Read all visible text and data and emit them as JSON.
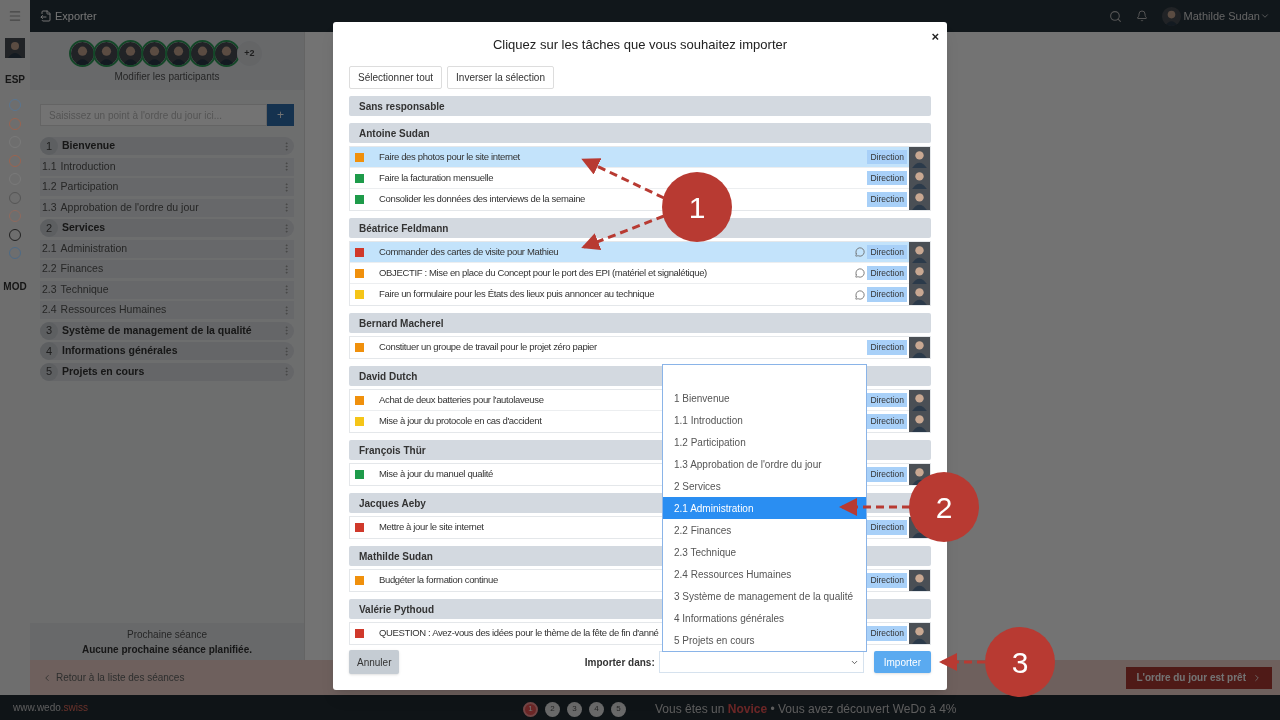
{
  "topbar": {
    "export": "Exporter",
    "user": "Mathilde Sudan"
  },
  "rail": {
    "top_label": "ESP",
    "bottom_label": "MOD",
    "circles": [
      {
        "color": "#5a7590"
      },
      {
        "color": "#9a6450"
      },
      {
        "color": "#7a7a7a"
      },
      {
        "color": "#9a6450"
      },
      {
        "color": "#7a7a7a"
      },
      {
        "color": "#555555"
      },
      {
        "color": "#8f6a5e"
      },
      {
        "color": "#222222"
      },
      {
        "color": "#4d6a86"
      }
    ]
  },
  "participants": {
    "extra": "+2",
    "link": "Modifier les participants"
  },
  "agenda_input": {
    "placeholder": "Saisissez un point à l'ordre du jour ici...",
    "add": "+"
  },
  "agenda": [
    {
      "number": "1",
      "title": "Bienvenue",
      "children": [
        {
          "number": "1.1",
          "title": "Introduction"
        },
        {
          "number": "1.2",
          "title": "Participation"
        },
        {
          "number": "1.3",
          "title": "Approbation de l'ordre du jour"
        }
      ]
    },
    {
      "number": "2",
      "title": "Services",
      "children": [
        {
          "number": "2.1",
          "title": "Administration"
        },
        {
          "number": "2.2",
          "title": "Finances"
        },
        {
          "number": "2.3",
          "title": "Technique"
        },
        {
          "number": "2.4",
          "title": "Ressources Humaines"
        }
      ]
    },
    {
      "number": "3",
      "title": "Système de management de la qualité"
    },
    {
      "number": "4",
      "title": "Informations générales"
    },
    {
      "number": "5",
      "title": "Projets en cours"
    }
  ],
  "next_meeting": {
    "label": "Prochaine séance",
    "value": "Aucune prochaine séance planifiée."
  },
  "footer": {
    "back": "Retour à la liste des séances",
    "ready": "L'ordre du jour est prêt"
  },
  "bottom_bar": {
    "site": "www.wedo",
    "site_suffix": ".swiss",
    "steps": [
      {
        "label": "1",
        "selected": true
      },
      {
        "label": "2",
        "selected": false
      },
      {
        "label": "3",
        "selected": false
      },
      {
        "label": "4",
        "selected": false
      },
      {
        "label": "5",
        "selected": false
      }
    ],
    "status_prefix": "Vous êtes un",
    "status_rank": "Novice",
    "status_suffix": "• Vous avez découvert WeDo à 4%"
  },
  "modal": {
    "title": "Cliquez sur les tâches que vous souhaitez importer",
    "close": "×",
    "actions": [
      "Sélectionner tout",
      "Inverser la sélection"
    ],
    "groups": [
      {
        "name": "Sans responsable"
      },
      {
        "name": "Antoine Sudan",
        "tasks": [
          {
            "title": "Faire des photos pour le site internet",
            "color": "#f0900c",
            "selected": true,
            "comment": false,
            "tag": "Direction"
          },
          {
            "title": "Faire la facturation mensuelle",
            "color": "#1e9b4a",
            "selected": false,
            "comment": false,
            "tag": "Direction"
          },
          {
            "title": "Consolider les données des interviews de la semaine",
            "color": "#1e9b4a",
            "selected": false,
            "comment": false,
            "tag": "Direction"
          }
        ]
      },
      {
        "name": "Béatrice Feldmann",
        "tasks": [
          {
            "title": "Commander des cartes de visite pour Mathieu",
            "color": "#d0392b",
            "selected": true,
            "comment": true,
            "tag": "Direction"
          },
          {
            "title": "OBJECTIF : Mise en place du Concept pour le port des EPI (matériel et signalétique)",
            "color": "#f0900c",
            "selected": false,
            "comment": true,
            "tag": "Direction"
          },
          {
            "title": "Faire un formulaire pour les États des lieux puis annoncer au technique",
            "color": "#f5c518",
            "selected": false,
            "comment": true,
            "tag": "Direction"
          }
        ]
      },
      {
        "name": "Bernard Macherel",
        "tasks": [
          {
            "title": "Constituer un groupe de travail pour le projet zéro papier",
            "color": "#f0900c",
            "selected": false,
            "comment": false,
            "tag": "Direction"
          }
        ]
      },
      {
        "name": "David Dutch",
        "tasks": [
          {
            "title": "Achat de deux batteries pour l'autolaveuse",
            "color": "#f0900c",
            "selected": false,
            "comment": false,
            "tag": "Direction"
          },
          {
            "title": "Mise à jour du protocole en cas d'accident",
            "color": "#f5c518",
            "selected": false,
            "comment": false,
            "tag": "Direction"
          }
        ]
      },
      {
        "name": "François Thür",
        "tasks": [
          {
            "title": "Mise à jour du manuel qualité",
            "color": "#1e9b4a",
            "selected": false,
            "comment": false,
            "tag": "Direction"
          }
        ]
      },
      {
        "name": "Jacques Aeby",
        "tasks": [
          {
            "title": "Mettre à jour le site internet",
            "color": "#d0392b",
            "selected": false,
            "comment": false,
            "tag": "Direction"
          }
        ]
      },
      {
        "name": "Mathilde Sudan",
        "tasks": [
          {
            "title": "Budgéter la formation continue",
            "color": "#f0900c",
            "selected": false,
            "comment": false,
            "tag": "Direction"
          }
        ]
      },
      {
        "name": "Valérie Pythoud",
        "tasks": [
          {
            "title": "QUESTION : Avez-vous des idées pour le thème de la fête de fin d'anné",
            "color": "#d0392b",
            "selected": false,
            "comment": false,
            "tag": "Direction"
          }
        ]
      }
    ],
    "cancel": "Annuler",
    "import_label": "Importer dans:",
    "import": "Importer",
    "dropdown": {
      "options": [
        {
          "label": "1 Bienvenue",
          "selected": false
        },
        {
          "label": "1.1 Introduction",
          "selected": false
        },
        {
          "label": "1.2 Participation",
          "selected": false
        },
        {
          "label": "1.3 Approbation de l'ordre du jour",
          "selected": false
        },
        {
          "label": "2 Services",
          "selected": false
        },
        {
          "label": "2.1 Administration",
          "selected": true
        },
        {
          "label": "2.2 Finances",
          "selected": false
        },
        {
          "label": "2.3 Technique",
          "selected": false
        },
        {
          "label": "2.4 Ressources Humaines",
          "selected": false
        },
        {
          "label": "3 Système de management de la qualité",
          "selected": false
        },
        {
          "label": "4 Informations générales",
          "selected": false
        },
        {
          "label": "5 Projets en cours",
          "selected": false
        }
      ]
    }
  },
  "callouts": [
    {
      "label": "1"
    },
    {
      "label": "2"
    },
    {
      "label": "3"
    }
  ]
}
